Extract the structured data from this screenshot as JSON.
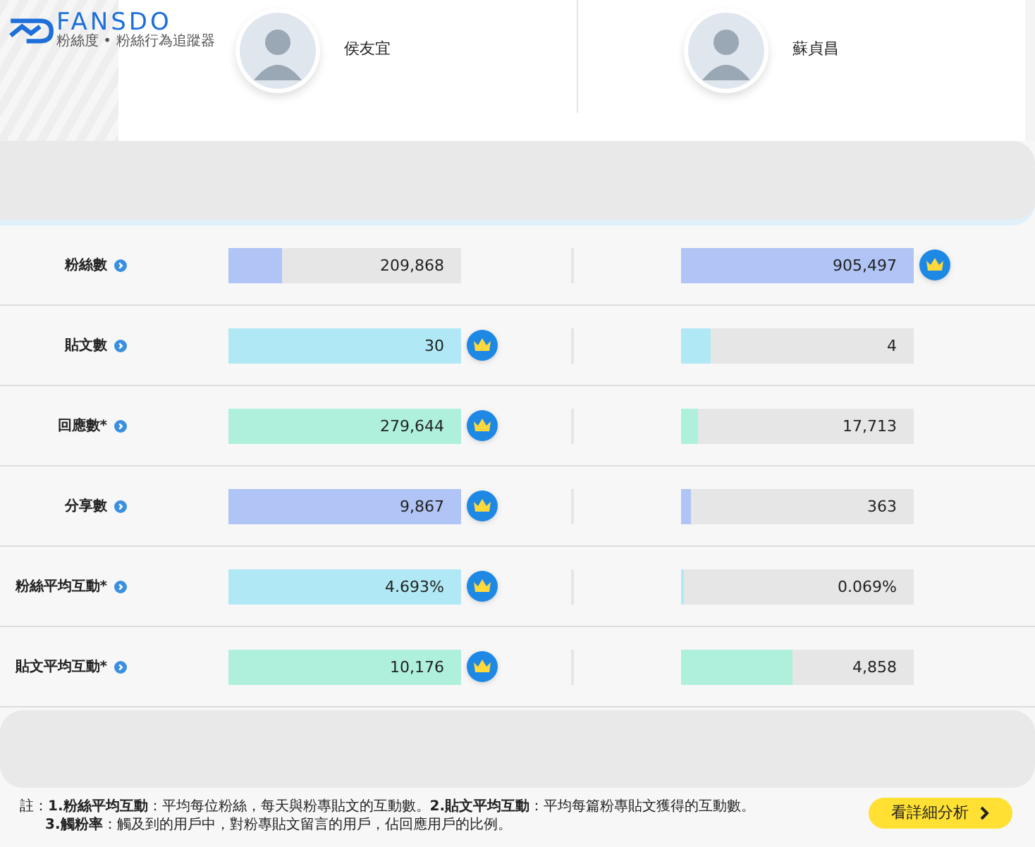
{
  "logo": {
    "wordmark": "FANSDO",
    "tagline": "粉絲度 • 粉絲行為追蹤器"
  },
  "candidates": [
    {
      "name": "侯友宜"
    },
    {
      "name": "蘇貞昌"
    }
  ],
  "metrics": [
    {
      "label": "粉絲數",
      "color": "#b0c4f5",
      "cells": [
        {
          "value": "209,868",
          "level": 0.23,
          "winner": false
        },
        {
          "value": "905,497",
          "level": 1,
          "winner": true
        }
      ]
    },
    {
      "label": "貼文數",
      "color": "#b0e9f5",
      "cells": [
        {
          "value": "30",
          "level": 1,
          "winner": true
        },
        {
          "value": "4",
          "level": 0.13,
          "winner": false
        }
      ]
    },
    {
      "label": "回應數*",
      "color": "#aef0dc",
      "cells": [
        {
          "value": "279,644",
          "level": 1,
          "winner": true
        },
        {
          "value": "17,713",
          "level": 0.07,
          "winner": false
        }
      ]
    },
    {
      "label": "分享數",
      "color": "#b0c4f5",
      "cells": [
        {
          "value": "9,867",
          "level": 1,
          "winner": true
        },
        {
          "value": "363",
          "level": 0.04,
          "winner": false
        }
      ]
    },
    {
      "label": "粉絲平均互動*",
      "color": "#b0e9f5",
      "cells": [
        {
          "value": "4.693%",
          "level": 1,
          "winner": true
        },
        {
          "value": "0.069%",
          "level": 0.015,
          "winner": false
        }
      ]
    },
    {
      "label": "貼文平均互動*",
      "color": "#aef0dc",
      "cells": [
        {
          "value": "10,176",
          "level": 1,
          "winner": true
        },
        {
          "value": "4,858",
          "level": 0.48,
          "winner": false
        }
      ]
    }
  ],
  "footnotes": [
    "註：**1.粉絲平均互動**：平均每位粉絲，每天與粉專貼文的互動數。**2.貼文平均互動**：平均每篇粉專貼文獲得的互動數。",
    "**3.觸粉率**：觸及到的用戶中，對粉專貼文留言的用戶，佔回應用戶的比例。"
  ],
  "detail_button": "看詳細分析"
}
